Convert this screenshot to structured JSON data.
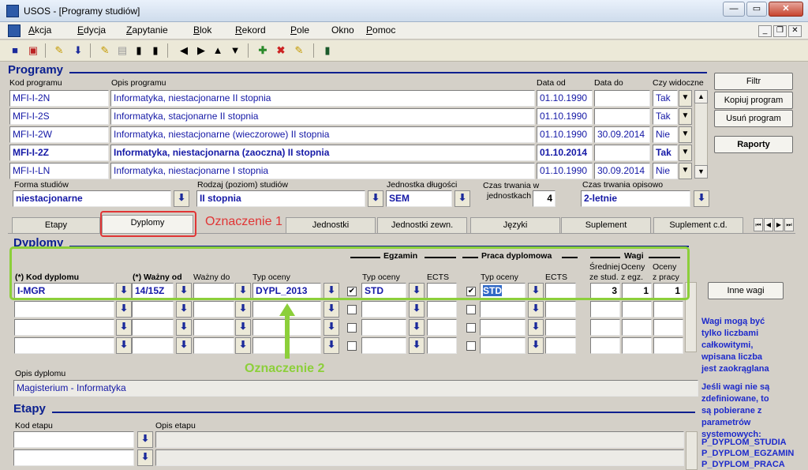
{
  "window": {
    "title": "USOS - [Programy studiów]"
  },
  "menu": [
    {
      "pre": "",
      "u": "A",
      "post": "kcja"
    },
    {
      "pre": "",
      "u": "E",
      "post": "dycja"
    },
    {
      "pre": "",
      "u": "Z",
      "post": "apytanie"
    },
    {
      "pre": "",
      "u": "B",
      "post": "lok"
    },
    {
      "pre": "",
      "u": "R",
      "post": "ekord"
    },
    {
      "pre": "",
      "u": "P",
      "post": "ole"
    },
    {
      "pre": "Okno",
      "u": "",
      "post": ""
    },
    {
      "pre": "",
      "u": "P",
      "post": "omoc"
    }
  ],
  "programy": {
    "title": "Programy",
    "headers": {
      "kod": "Kod programu",
      "opis": "Opis programu",
      "data_od": "Data od",
      "data_do": "Data do",
      "widoczne": "Czy widoczne"
    },
    "rows": [
      {
        "kod": "MFI-I-2N",
        "opis": "Informatyka, niestacjonarne II stopnia",
        "od": "01.10.1990",
        "do": "",
        "widoczne": "Tak"
      },
      {
        "kod": "MFI-I-2S",
        "opis": "Informatyka, stacjonarne II stopnia",
        "od": "01.10.1990",
        "do": "",
        "widoczne": "Tak"
      },
      {
        "kod": "MFI-I-2W",
        "opis": "Informatyka, niestacjonarne (wieczorowe) II stopnia",
        "od": "01.10.1990",
        "do": "30.09.2014",
        "widoczne": "Nie"
      },
      {
        "kod": "MFI-I-2Z",
        "opis": "Informatyka, niestacjonarna (zaoczna) II stopnia",
        "od": "01.10.2014",
        "do": "",
        "widoczne": "Tak"
      },
      {
        "kod": "MFI-I-LN",
        "opis": "Informatyka, niestacjonarne I stopnia",
        "od": "01.10.1990",
        "do": "30.09.2014",
        "widoczne": "Nie"
      }
    ],
    "selected_row": 3
  },
  "buttons": {
    "filtr": "Filtr",
    "kopiuj": "Kopiuj program",
    "usun": "Usuń program",
    "raporty": "Raporty",
    "inne_wagi": "Inne wagi"
  },
  "details": {
    "forma_label": "Forma studiów",
    "forma": "niestacjonarne",
    "rodzaj_label": "Rodzaj (poziom) studiów",
    "rodzaj": "II stopnia",
    "jednostka_label": "Jednostka długości",
    "jednostka": "SEM",
    "czas_label1": "Czas trwania w",
    "czas_label2": "jednostkach",
    "czas": "4",
    "czas_opis_label": "Czas trwania opisowo",
    "czas_opis": "2-letnie"
  },
  "tabs": [
    "Etapy",
    "Dyplomy",
    "Jednostki",
    "Jednostki zewn.",
    "Języki",
    "Suplement",
    "Suplement c.d."
  ],
  "annotations": {
    "a1": "Oznaczenie 1",
    "a2": "Oznaczenie 2"
  },
  "dyplomy": {
    "title": "Dyplomy",
    "group_egzamin": "Egzamin",
    "group_praca": "Praca dyplomowa",
    "group_wagi": "Wagi",
    "h_kod": "(*) Kod dyplomu",
    "h_wazny_od": "(*) Ważny od",
    "h_wazny_do": "Ważny do",
    "h_typ": "Typ oceny",
    "h_e_typ": "Typ oceny",
    "h_e_ects": "ECTS",
    "h_p_typ": "Typ oceny",
    "h_p_ects": "ECTS",
    "h_w1a": "Średniej",
    "h_w1b": "ze stud.",
    "h_w2a": "Oceny",
    "h_w2b": "z egz.",
    "h_w3a": "Oceny",
    "h_w3b": "z pracy",
    "row": {
      "kod": "I-MGR",
      "od": "14/15Z",
      "do": "",
      "typ": "DYPL_2013",
      "e_typ": "STD",
      "e_ects": "",
      "p_typ": "STD",
      "p_ects": "",
      "w1": "3",
      "w2": "1",
      "w3": "1"
    },
    "opis_label": "Opis dyplomu",
    "opis": "Magisterium - Informatyka"
  },
  "info_text1": "Wagi mogą być tylko liczbami całkowitymi, wpisana liczba jest zaokrąglana",
  "info_text2": "Jeśli wagi nie są zdefiniowane, to są pobierane z parametrów systemowych:",
  "params": [
    "P_DYPLOM_STUDIA",
    "P_DYPLOM_EGZAMIN",
    "P_DYPLOM_PRACA"
  ],
  "etapy": {
    "title": "Etapy",
    "h_kod": "Kod etapu",
    "h_opis": "Opis etapu"
  },
  "colors": {
    "header_blue": "#0a1f8f",
    "field_text": "#1418a6",
    "annot_red": "#e03535",
    "annot_green": "#8ccf3a"
  }
}
